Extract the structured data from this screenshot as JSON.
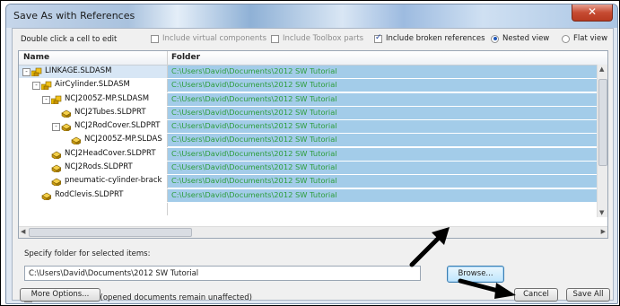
{
  "window": {
    "title": "Save As with References",
    "close_glyph": "✕"
  },
  "toolbar": {
    "hint": "Double click a cell to edit",
    "include_virtual": {
      "label": "Include virtual components",
      "checked": false,
      "enabled": false
    },
    "include_toolbox": {
      "label": "Include Toolbox parts",
      "checked": false,
      "enabled": false
    },
    "include_broken": {
      "label": "Include broken references",
      "checked": true,
      "enabled": true
    },
    "nested_view": {
      "label": "Nested view",
      "selected": true
    },
    "flat_view": {
      "label": "Flat view",
      "selected": false
    }
  },
  "table": {
    "columns": [
      "Name",
      "Folder"
    ],
    "rows": [
      {
        "name": "LINKAGE.SLDASM",
        "folder": "C:\\Users\\David\\Documents\\2012 SW Tutorial",
        "type": "assembly",
        "depth": 0,
        "expander": "-"
      },
      {
        "name": "AirCylinder.SLDASM",
        "folder": "C:\\Users\\David\\Documents\\2012 SW Tutorial",
        "type": "assembly",
        "depth": 1,
        "expander": "-"
      },
      {
        "name": "NCJ2005Z-MP.SLDASM",
        "folder": "C:\\Users\\David\\Documents\\2012 SW Tutorial",
        "type": "assembly",
        "depth": 2,
        "expander": "-"
      },
      {
        "name": "NCJ2Tubes.SLDPRT",
        "folder": "C:\\Users\\David\\Documents\\2012 SW Tutorial",
        "type": "part",
        "depth": 3,
        "expander": ""
      },
      {
        "name": "NCJ2RodCover.SLDPRT",
        "folder": "C:\\Users\\David\\Documents\\2012 SW Tutorial",
        "type": "part",
        "depth": 3,
        "expander": "-"
      },
      {
        "name": "NCJ2005Z-MP.SLDAS",
        "folder": "C:\\Users\\David\\Documents\\2012 SW Tutorial",
        "type": "part",
        "depth": 4,
        "expander": ""
      },
      {
        "name": "NCJ2HeadCover.SLDPRT",
        "folder": "C:\\Users\\David\\Documents\\2012 SW Tutorial",
        "type": "part",
        "depth": 2,
        "expander": ""
      },
      {
        "name": "NCJ2Rods.SLDPRT",
        "folder": "C:\\Users\\David\\Documents\\2012 SW Tutorial",
        "type": "part",
        "depth": 2,
        "expander": ""
      },
      {
        "name": "pneumatic-cylinder-brack",
        "folder": "C:\\Users\\David\\Documents\\2012 SW Tutorial",
        "type": "part",
        "depth": 2,
        "expander": ""
      },
      {
        "name": "RodClevis.SLDPRT",
        "folder": "C:\\Users\\David\\Documents\\2012 SW Tutorial",
        "type": "part",
        "depth": 1,
        "expander": ""
      }
    ]
  },
  "folder_section": {
    "label": "Specify folder for selected items:",
    "path": "C:\\Users\\David\\Documents\\2012 SW Tutorial",
    "browse_label": "Browse..."
  },
  "save_copy": {
    "label": "Save all as copy (opened documents remain unaffected)",
    "checked": false
  },
  "buttons": {
    "more_options": "More Options...",
    "cancel": "Cancel",
    "save_all": "Save All"
  },
  "colors": {
    "folder_bg": "#a3cce9",
    "folder_text": "#2d9d3c",
    "arrow": "#000000"
  },
  "icons": {
    "assembly": "assembly-icon",
    "part": "part-icon",
    "pointer": "annotation-arrow-icon"
  }
}
